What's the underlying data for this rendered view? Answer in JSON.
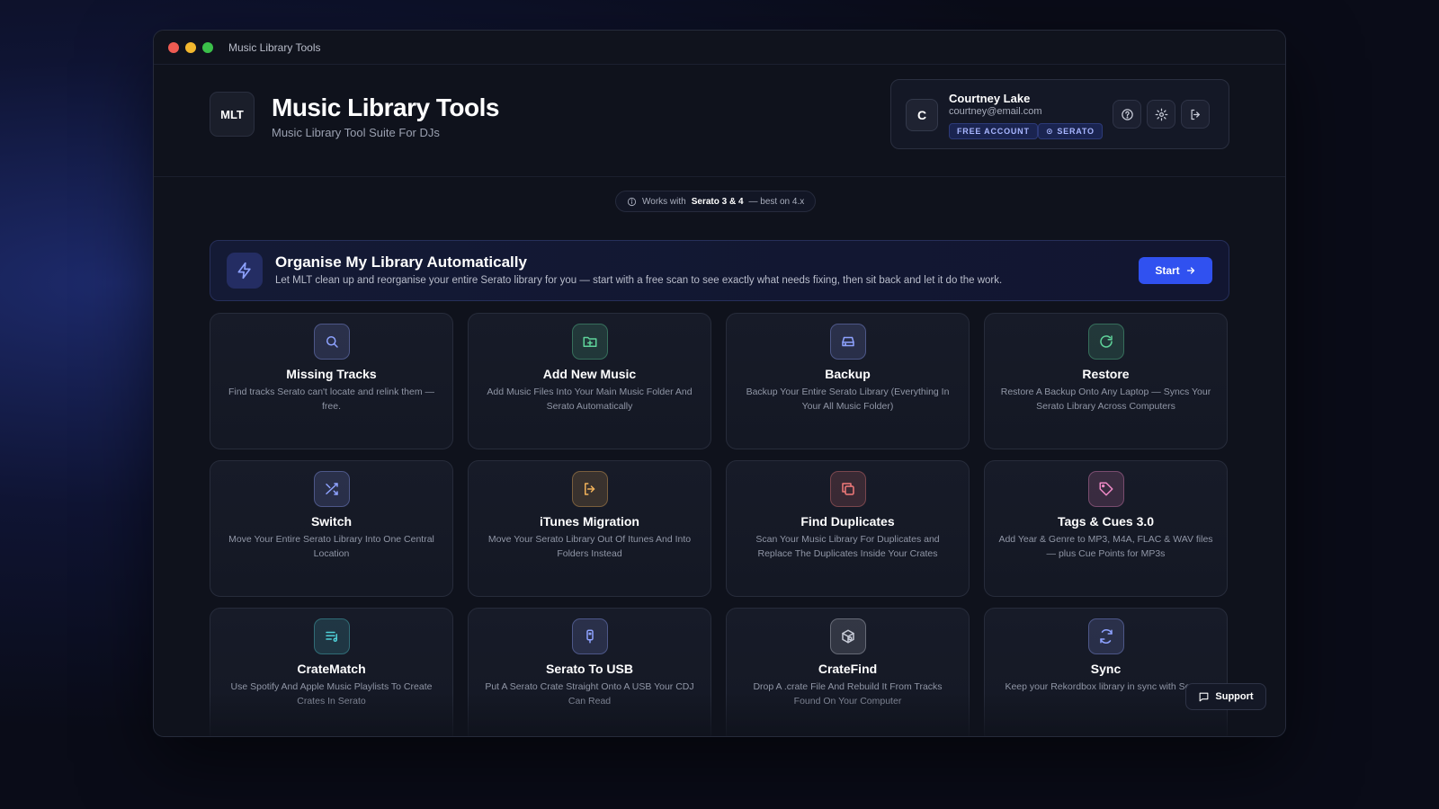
{
  "window": {
    "title": "Music Library Tools"
  },
  "header": {
    "logo_text": "MLT",
    "app_name": "Music Library Tools",
    "app_subtitle": "Music Library Tool Suite For DJs"
  },
  "account": {
    "avatar_letter": "C",
    "name": "Courtney Lake",
    "email": "courtney@email.com",
    "badges": [
      "FREE ACCOUNT",
      "SERATO"
    ]
  },
  "compat": {
    "prefix": "Works with",
    "highlight": "Serato 3 & 4",
    "suffix": "— best on 4.x"
  },
  "banner": {
    "title": "Organise My Library Automatically",
    "description": "Let MLT clean up and reorganise your entire Serato library for you — start with a free scan to see exactly what needs fixing, then sit back and let it do the work.",
    "button": "Start"
  },
  "tools": [
    {
      "title": "Missing Tracks",
      "desc": "Find tracks Serato can't locate and relink them — free.",
      "icon": "search-icon",
      "color": "#8ea2ff"
    },
    {
      "title": "Add New Music",
      "desc": "Add Music Files Into Your Main Music Folder And Serato Automatically",
      "icon": "folder-plus-icon",
      "color": "#5fd39a"
    },
    {
      "title": "Backup",
      "desc": "Backup Your Entire Serato Library (Everything In Your All Music Folder)",
      "icon": "hard-drive-icon",
      "color": "#8ea2ff"
    },
    {
      "title": "Restore",
      "desc": "Restore A Backup Onto Any Laptop — Syncs Your Serato Library Across Computers",
      "icon": "refresh-icon",
      "color": "#5fd39a"
    },
    {
      "title": "Switch",
      "desc": "Move Your Entire Serato Library Into One Central Location",
      "icon": "shuffle-icon",
      "color": "#8ea2ff"
    },
    {
      "title": "iTunes Migration",
      "desc": "Move Your Serato Library Out Of Itunes And Into Folders Instead",
      "icon": "log-out-icon",
      "color": "#f2b25a"
    },
    {
      "title": "Find Duplicates",
      "desc": "Scan Your Music Library For Duplicates and Replace The Duplicates Inside Your Crates",
      "icon": "copy-icon",
      "color": "#f27a7a"
    },
    {
      "title": "Tags & Cues 3.0",
      "desc": "Add Year & Genre to MP3, M4A, FLAC & WAV files — plus Cue Points for MP3s",
      "icon": "tag-icon",
      "color": "#f08ac7"
    },
    {
      "title": "CrateMatch",
      "desc": "Use Spotify And Apple Music Playlists To Create Crates In Serato",
      "icon": "playlist-icon",
      "color": "#4fd0d8"
    },
    {
      "title": "Serato To USB",
      "desc": "Put A Serato Crate Straight Onto A USB Your CDJ Can Read",
      "icon": "usb-icon",
      "color": "#8ea2ff"
    },
    {
      "title": "CrateFind",
      "desc": "Drop A .crate File And Rebuild It From Tracks Found On Your Computer",
      "icon": "box-search-icon",
      "color": "#c8ccd8"
    },
    {
      "title": "Sync",
      "desc": "Keep your Rekordbox library in sync with Serato",
      "icon": "sync-icon",
      "color": "#8ea2ff"
    }
  ],
  "support": {
    "label": "Support"
  }
}
